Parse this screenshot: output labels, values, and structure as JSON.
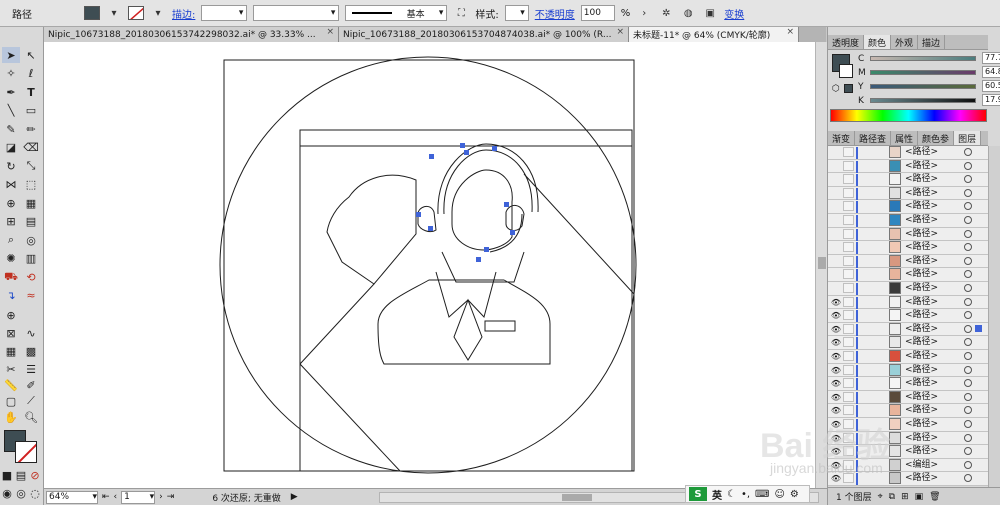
{
  "control_bar": {
    "object_type": "路径",
    "stroke_label": "描边:",
    "stroke_weight": "",
    "brush_name": "基本",
    "style_label": "样式:",
    "opacity_label": "不透明度",
    "opacity_value": "100",
    "opacity_unit": "%",
    "transform_label": "变换",
    "fill_color": "#3e4d53"
  },
  "tabs": [
    {
      "label": "Nipic_10673188_20180306153742298032.ai* @ 33.33% ...",
      "close": "×"
    },
    {
      "label": "Nipic_10673188_20180306153704874038.ai* @ 100% (R...",
      "close": "×"
    },
    {
      "label": "未标题-11* @ 64% (CMYK/轮廓)",
      "close": "×"
    }
  ],
  "color_panel": {
    "tabs": [
      "透明度",
      "颜色",
      "外观",
      "描边"
    ],
    "active_tab": "颜色",
    "sliders": [
      {
        "letter": "C",
        "value": "77.73",
        "unit": "%",
        "fraction": 0.7773
      },
      {
        "letter": "M",
        "value": "64.84",
        "unit": "%",
        "fraction": 0.6484
      },
      {
        "letter": "Y",
        "value": "60.55",
        "unit": "%",
        "fraction": 0.6055
      },
      {
        "letter": "K",
        "value": "17.97",
        "unit": "%",
        "fraction": 0.1797
      }
    ]
  },
  "layers_panel": {
    "tabs": [
      "渐变",
      "路径查",
      "属性",
      "颜色参",
      "图层"
    ],
    "active_tab": "图层",
    "rows": [
      {
        "name": "<路径>",
        "visible": false,
        "thumb": "#e8d4c8"
      },
      {
        "name": "<路径>",
        "visible": false,
        "thumb": "#3a8fb4"
      },
      {
        "name": "<路径>",
        "visible": false,
        "thumb": "#f2f2f2"
      },
      {
        "name": "<路径>",
        "visible": false,
        "thumb": "#e0e0e0"
      },
      {
        "name": "<路径>",
        "visible": false,
        "thumb": "#2a79b8"
      },
      {
        "name": "<路径>",
        "visible": false,
        "thumb": "#2f86c0"
      },
      {
        "name": "<路径>",
        "visible": false,
        "thumb": "#e8c2b0"
      },
      {
        "name": "<路径>",
        "visible": false,
        "thumb": "#f0c8b4"
      },
      {
        "name": "<路径>",
        "visible": false,
        "thumb": "#d89880"
      },
      {
        "name": "<路径>",
        "visible": false,
        "thumb": "#e8b49c"
      },
      {
        "name": "<路径>",
        "visible": false,
        "thumb": "#3a3a3a"
      },
      {
        "name": "<路径>",
        "visible": true,
        "thumb": "#f0f0f0"
      },
      {
        "name": "<路径>",
        "visible": true,
        "thumb": "#f4f4f4"
      },
      {
        "name": "<路径>",
        "visible": true,
        "thumb": "#eeeeee",
        "selected": true
      },
      {
        "name": "<路径>",
        "visible": true,
        "thumb": "#e8e8e8"
      },
      {
        "name": "<路径>",
        "visible": true,
        "thumb": "#d8503c"
      },
      {
        "name": "<路径>",
        "visible": true,
        "thumb": "#9ad0d8"
      },
      {
        "name": "<路径>",
        "visible": true,
        "thumb": "#f4f4f4"
      },
      {
        "name": "<路径>",
        "visible": true,
        "thumb": "#5a4a3a"
      },
      {
        "name": "<路径>",
        "visible": true,
        "thumb": "#e8b49c"
      },
      {
        "name": "<路径>",
        "visible": true,
        "thumb": "#f0d0c0"
      },
      {
        "name": "<路径>",
        "visible": true,
        "thumb": "#dcdcdc"
      },
      {
        "name": "<路径>",
        "visible": true,
        "thumb": "#e4e4e4"
      },
      {
        "name": "<编组>",
        "visible": true,
        "thumb": "#d0d0d0"
      },
      {
        "name": "<路径>",
        "visible": true,
        "thumb": "#c8c8c8"
      }
    ],
    "footer_label": "1 个图层"
  },
  "status_bar": {
    "zoom": "64%",
    "artboard": "1",
    "status_text": "6 次还原; 无重做"
  },
  "ime": {
    "logo": "S",
    "lang": "英"
  },
  "watermark": {
    "line1": "Bai 经验",
    "line2": "jingyan.baidu.com"
  }
}
